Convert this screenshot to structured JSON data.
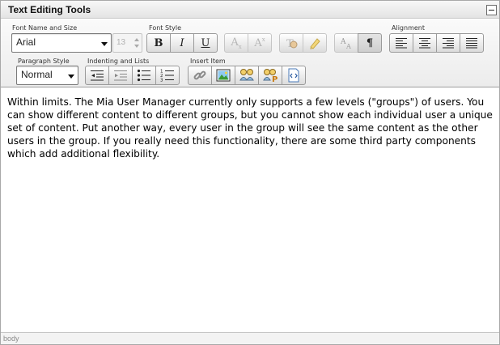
{
  "window": {
    "title": "Text Editing Tools"
  },
  "toolbar": {
    "font_name_size": {
      "label": "Font Name and Size",
      "font_value": "Arial",
      "size_value": "13"
    },
    "font_style": {
      "label": "Font Style",
      "bold": "B",
      "italic": "I",
      "underline": "U"
    },
    "alignment": {
      "label": "Alignment"
    },
    "paragraph_style": {
      "label": "Paragraph Style",
      "value": "Normal"
    },
    "indenting": {
      "label": "Indenting and Lists"
    },
    "insert_item": {
      "label": "Insert Item"
    },
    "paragraph_mark": "¶"
  },
  "editor": {
    "content": "Within limits. The Mia User Manager currently only supports a few levels (\"groups\") of users. You can show different content to different groups, but you cannot show each individual user a unique set of content. Put another way, every user in the group will see the same content as the other users in the group. If you really need this functionality, there are some third party components which add additional flexibility."
  },
  "status": {
    "path": "body"
  },
  "icons": {
    "subscript": "subscript-icon",
    "superscript": "superscript-icon",
    "text_color": "text-color-icon",
    "highlight": "highlight-icon",
    "change_case": "change-case-icon",
    "show_marks": "paragraph-mark-icon",
    "align_left": "align-left-icon",
    "align_center": "align-center-icon",
    "align_right": "align-right-icon",
    "align_justify": "align-justify-icon",
    "outdent": "outdent-icon",
    "indent": "indent-icon",
    "bullets": "bullet-list-icon",
    "numbers": "numbered-list-icon",
    "link": "link-icon",
    "image": "image-icon",
    "people": "people-icon",
    "people_p": "people-p-icon",
    "code": "code-file-icon"
  }
}
